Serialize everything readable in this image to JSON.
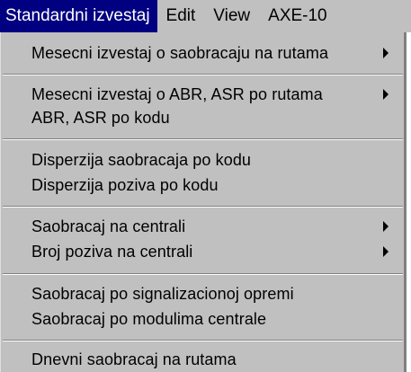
{
  "menubar": {
    "items": [
      {
        "label": "Standardni izvestaj"
      },
      {
        "label": "Edit"
      },
      {
        "label": "View"
      },
      {
        "label": "AXE-10"
      }
    ]
  },
  "dropdown": {
    "groups": [
      [
        {
          "label": "Mesecni izvestaj o saobracaju na rutama",
          "submenu": true
        }
      ],
      [
        {
          "label": "Mesecni izvestaj o ABR, ASR po rutama",
          "submenu": true
        },
        {
          "label": "ABR, ASR po kodu",
          "submenu": false
        }
      ],
      [
        {
          "label": "Disperzija saobracaja po kodu",
          "submenu": false
        },
        {
          "label": "Disperzija poziva po kodu",
          "submenu": false
        }
      ],
      [
        {
          "label": "Saobracaj na centrali",
          "submenu": true
        },
        {
          "label": "Broj poziva na centrali",
          "submenu": true
        }
      ],
      [
        {
          "label": "Saobracaj po signalizacionoj opremi",
          "submenu": false
        },
        {
          "label": "Saobracaj po modulima centrale",
          "submenu": false
        }
      ],
      [
        {
          "label": "Dnevni saobracaj na rutama",
          "submenu": false
        }
      ]
    ]
  },
  "colors": {
    "menu_background": "#c0c0c0",
    "highlight_background": "#000080",
    "highlight_text": "#ffffff",
    "text": "#000000"
  }
}
